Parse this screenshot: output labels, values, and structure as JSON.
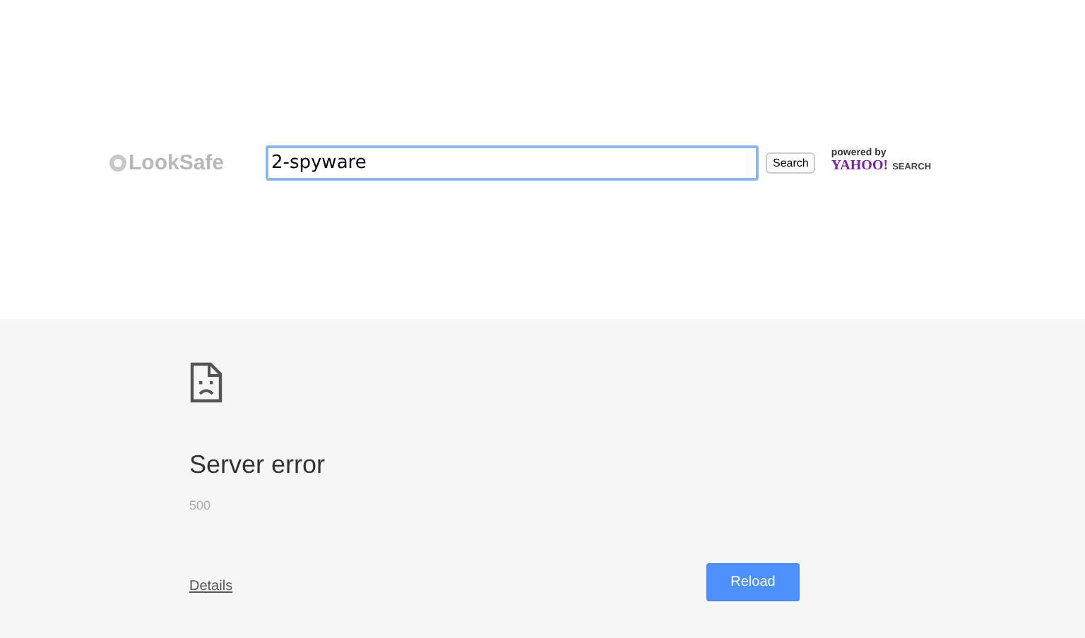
{
  "header": {
    "logo": "LookSafe",
    "search": {
      "value": "2-spyware",
      "focused": true
    },
    "search_button": "Search",
    "powered_by": "powered by",
    "provider_logo": "YAHOO!",
    "provider_suffix": "SEARCH"
  },
  "error": {
    "title": "Server error",
    "code": "500",
    "details_link": "Details",
    "reload_button": "Reload"
  }
}
